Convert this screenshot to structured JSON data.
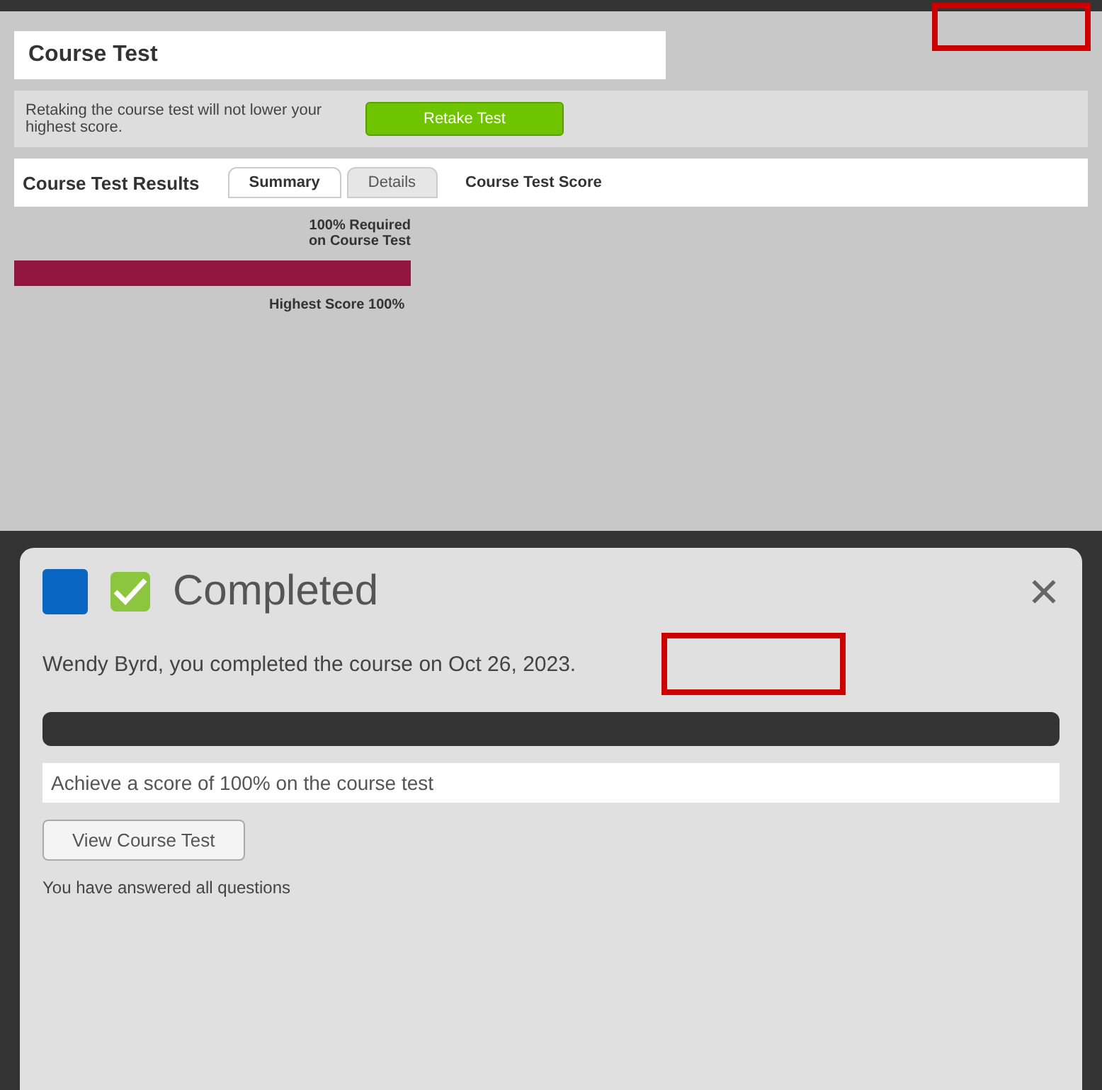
{
  "course_panel": {
    "title": "Course Test",
    "retake_note": "Retaking the course test will not lower your highest score.",
    "retake_button": "Retake Test",
    "results_heading": "Course Test Results",
    "tabs": [
      {
        "label": "Summary",
        "selected": true
      },
      {
        "label": "Details",
        "selected": false
      }
    ],
    "score_heading": "Course Test Score",
    "requirement": "100% Required on Course Test",
    "score_bar": {
      "level": 1
    },
    "highest_score": "Highest Score 100%",
    "highlighted": true
  },
  "completion_dialog": {
    "checked": true,
    "status": "Completed",
    "message": "Wendy Byrd, you completed the course on Oct 26, 2023.",
    "highlighted": true,
    "requirement_text": "Achieve a score of 100% on the course test",
    "answered_text": "You have answered all questions",
    "view_button": "View Course Test"
  }
}
